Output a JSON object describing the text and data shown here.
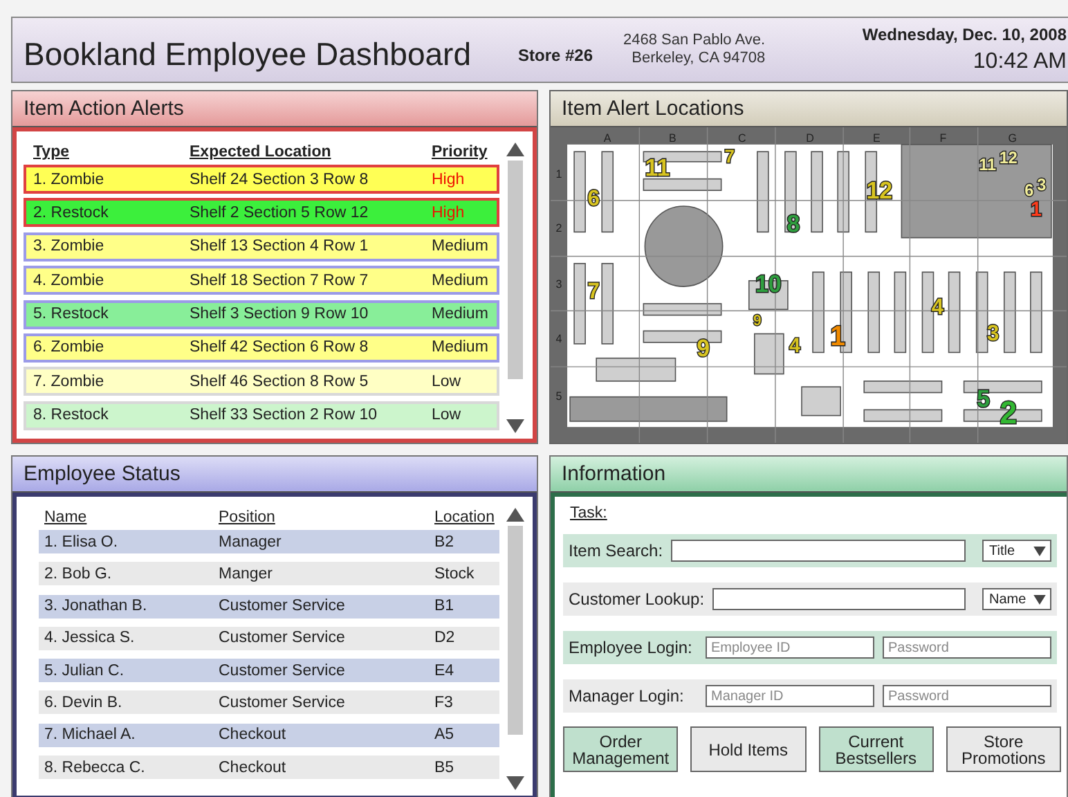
{
  "header": {
    "title": "Bookland Employee Dashboard",
    "store": "Store #26",
    "address_line_1": "2468 San Pablo Ave.",
    "address_line_2": "Berkeley, CA 94708",
    "date": "Wednesday, Dec. 10, 2008",
    "time": "10:42 AM"
  },
  "alerts": {
    "title": "Item Action Alerts",
    "columns": [
      "Type",
      "Expected Location",
      "Priority"
    ],
    "rows": [
      {
        "type": "1. Zombie",
        "location": "Shelf 24 Section 3 Row 8",
        "priority": "High",
        "urgent": true,
        "outlined": true,
        "color": "#ffff55"
      },
      {
        "type": "2. Restock",
        "location": "Shelf 2 Section 5 Row 12",
        "priority": "High",
        "urgent": true,
        "outlined": true,
        "color": "#3cef3c"
      },
      {
        "type": "3. Zombie",
        "location": "Shelf 13 Section 4 Row 1",
        "priority": "Medium",
        "urgent": false,
        "outlined": true,
        "color": "#ffff88"
      },
      {
        "type": "4. Zombie",
        "location": "Shelf 18 Section 7 Row 7",
        "priority": "Medium",
        "urgent": false,
        "outlined": true,
        "color": "#ffff88"
      },
      {
        "type": "5. Restock",
        "location": "Shelf 3 Section 9 Row 10",
        "priority": "Medium",
        "urgent": false,
        "outlined": true,
        "color": "#88ee99"
      },
      {
        "type": "6. Zombie",
        "location": "Shelf 42 Section 6 Row 8",
        "priority": "Medium",
        "urgent": false,
        "outlined": true,
        "color": "#ffff88"
      },
      {
        "type": "7. Zombie",
        "location": "Shelf 46 Section 8 Row 5",
        "priority": "Low",
        "urgent": false,
        "outlined": false,
        "color": "#ffffc4"
      },
      {
        "type": "8. Restock",
        "location": "Shelf 33 Section 2 Row 10",
        "priority": "Low",
        "urgent": false,
        "outlined": false,
        "color": "#ccf5cc"
      }
    ]
  },
  "map": {
    "title": "Item Alert Locations",
    "columns": [
      "A",
      "B",
      "C",
      "D",
      "E",
      "F",
      "G"
    ],
    "rows": [
      "1",
      "2",
      "3",
      "4",
      "5"
    ],
    "markers": [
      {
        "label": "11",
        "color": "#d8c420"
      },
      {
        "label": "7",
        "color": "#d8c420"
      },
      {
        "label": "6",
        "color": "#d8c420"
      },
      {
        "label": "12",
        "color": "#d8c420"
      },
      {
        "label": "8",
        "color": "#2f9f3f"
      },
      {
        "label": "11",
        "color": "#f2ee9a"
      },
      {
        "label": "12",
        "color": "#f2ee9a"
      },
      {
        "label": "6",
        "color": "#f2ee9a"
      },
      {
        "label": "3",
        "color": "#f2ee9a"
      },
      {
        "label": "1",
        "color": "#ff3b1a"
      },
      {
        "label": "7",
        "color": "#d8c420"
      },
      {
        "label": "10",
        "color": "#2f9f3f"
      },
      {
        "label": "9",
        "color": "#d8c420"
      },
      {
        "label": "9",
        "color": "#d8c420"
      },
      {
        "label": "4",
        "color": "#d8c420"
      },
      {
        "label": "1",
        "color": "#f08a00"
      },
      {
        "label": "4",
        "color": "#d8c420"
      },
      {
        "label": "3",
        "color": "#d8c420"
      },
      {
        "label": "5",
        "color": "#2f9f3f"
      },
      {
        "label": "2",
        "color": "#33b833"
      }
    ]
  },
  "employees": {
    "title": "Employee Status",
    "columns": [
      "Name",
      "Position",
      "Location"
    ],
    "rows": [
      {
        "name": "1. Elisa O.",
        "position": "Manager",
        "location": "B2"
      },
      {
        "name": "2. Bob G.",
        "position": "Manger",
        "location": "Stock"
      },
      {
        "name": "3. Jonathan B.",
        "position": "Customer Service",
        "location": "B1"
      },
      {
        "name": "4. Jessica S.",
        "position": "Customer Service",
        "location": "D2"
      },
      {
        "name": "5. Julian C.",
        "position": "Customer Service",
        "location": "E4"
      },
      {
        "name": "6. Devin B.",
        "position": "Customer Service",
        "location": "F3"
      },
      {
        "name": "7. Michael A.",
        "position": "Checkout",
        "location": "A5"
      },
      {
        "name": "8. Rebecca C.",
        "position": "Checkout",
        "location": "B5"
      }
    ]
  },
  "information": {
    "title": "Information",
    "task_label": "Task:",
    "rows": [
      {
        "kind": "search",
        "label": "Item Search:",
        "option": "Title"
      },
      {
        "kind": "search",
        "label": "Customer Lookup:",
        "option": "Name"
      },
      {
        "kind": "login",
        "label": "Employee Login:",
        "placeholders": [
          "Employee ID",
          "Password"
        ]
      },
      {
        "kind": "login",
        "label": "Manager Login:",
        "placeholders": [
          "Manager ID",
          "Password"
        ]
      }
    ],
    "buttons": [
      "Order Management",
      "Hold Items",
      "Current Bestsellers",
      "Store Promotions"
    ]
  }
}
